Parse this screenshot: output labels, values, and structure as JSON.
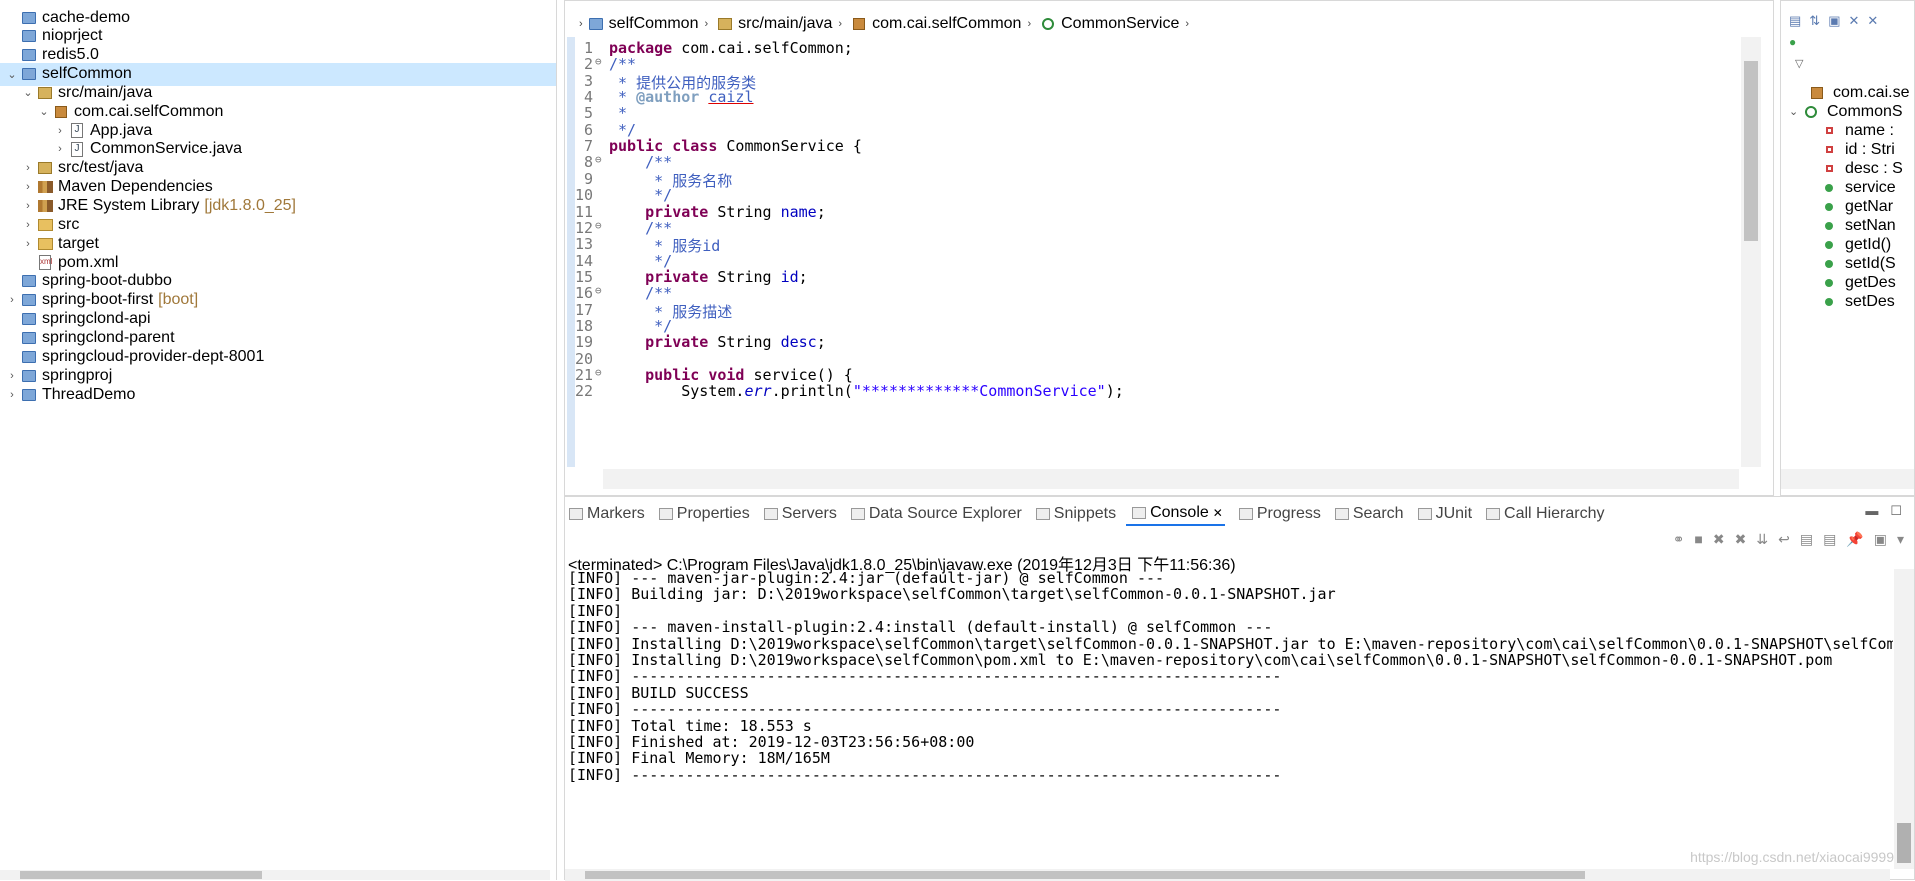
{
  "explorer": {
    "items": [
      {
        "label": "cache-demo",
        "suffix": "",
        "level": 0,
        "icon": "project-icon",
        "arrow": ""
      },
      {
        "label": "nioprject",
        "suffix": "",
        "level": 0,
        "icon": "project-icon",
        "arrow": ""
      },
      {
        "label": "redis5.0",
        "suffix": "",
        "level": 0,
        "icon": "project-icon",
        "arrow": ""
      },
      {
        "label": "selfCommon",
        "suffix": "",
        "level": 0,
        "icon": "maven-project-icon",
        "arrow": "v",
        "selected": true
      },
      {
        "label": "src/main/java",
        "suffix": "",
        "level": 1,
        "icon": "source-folder-icon",
        "arrow": "v"
      },
      {
        "label": "com.cai.selfCommon",
        "suffix": "",
        "level": 2,
        "icon": "package-icon",
        "arrow": "v"
      },
      {
        "label": "App.java",
        "suffix": "",
        "level": 3,
        "icon": "java-file-icon",
        "arrow": ">"
      },
      {
        "label": "CommonService.java",
        "suffix": "",
        "level": 3,
        "icon": "java-file-icon",
        "arrow": ">"
      },
      {
        "label": "src/test/java",
        "suffix": "",
        "level": 1,
        "icon": "source-folder-icon",
        "arrow": ">"
      },
      {
        "label": "Maven Dependencies",
        "suffix": "",
        "level": 1,
        "icon": "library-icon",
        "arrow": ">"
      },
      {
        "label": "JRE System Library",
        "suffix": "[jdk1.8.0_25]",
        "level": 1,
        "icon": "library-icon",
        "arrow": ">"
      },
      {
        "label": "src",
        "suffix": "",
        "level": 1,
        "icon": "folder-icon",
        "arrow": ">"
      },
      {
        "label": "target",
        "suffix": "",
        "level": 1,
        "icon": "folder-icon",
        "arrow": ">"
      },
      {
        "label": "pom.xml",
        "suffix": "",
        "level": 1,
        "icon": "xml-file-icon",
        "arrow": ""
      },
      {
        "label": "spring-boot-dubbo",
        "suffix": "",
        "level": 0,
        "icon": "project-icon",
        "arrow": ""
      },
      {
        "label": "spring-boot-first",
        "suffix": "[boot]",
        "level": 0,
        "icon": "spring-project-icon",
        "arrow": ">"
      },
      {
        "label": "springclond-api",
        "suffix": "",
        "level": 0,
        "icon": "project-icon",
        "arrow": ""
      },
      {
        "label": "springclond-parent",
        "suffix": "",
        "level": 0,
        "icon": "project-icon",
        "arrow": ""
      },
      {
        "label": "springcloud-provider-dept-8001",
        "suffix": "",
        "level": 0,
        "icon": "project-icon",
        "arrow": ""
      },
      {
        "label": "springproj",
        "suffix": "",
        "level": 0,
        "icon": "spring-project-icon",
        "arrow": ">"
      },
      {
        "label": "ThreadDemo",
        "suffix": "",
        "level": 0,
        "icon": "project-icon",
        "arrow": ">"
      }
    ]
  },
  "breadcrumb": [
    {
      "label": "selfCommon",
      "icon": "maven-project-icon"
    },
    {
      "label": "src/main/java",
      "icon": "source-folder-icon"
    },
    {
      "label": "com.cai.selfCommon",
      "icon": "package-icon"
    },
    {
      "label": "CommonService",
      "icon": "class-icon"
    }
  ],
  "code": [
    {
      "n": "1",
      "fold": "",
      "html": "<span class='kw'>package</span> com.cai.selfCommon;"
    },
    {
      "n": "2",
      "fold": "⊖",
      "html": "<span class='cm'>/**</span>"
    },
    {
      "n": "3",
      "fold": "",
      "html": "<span class='cm'> * 提供公用的服务类</span>"
    },
    {
      "n": "4",
      "fold": "",
      "html": "<span class='cm'> * <b style=\"color:#7f9fbf\">@author</b> <u style=\"text-decoration-color:#d00\">caizl</u></span>"
    },
    {
      "n": "5",
      "fold": "",
      "html": "<span class='cm'> *</span>"
    },
    {
      "n": "6",
      "fold": "",
      "html": "<span class='cm'> */</span>"
    },
    {
      "n": "7",
      "fold": "",
      "html": "<span class='kw'>public class</span> CommonService {"
    },
    {
      "n": "8",
      "fold": "⊖",
      "html": "    <span class='cm'>/**</span>"
    },
    {
      "n": "9",
      "fold": "",
      "html": "<span class='cm'>     * 服务名称</span>"
    },
    {
      "n": "10",
      "fold": "",
      "html": "<span class='cm'>     */</span>"
    },
    {
      "n": "11",
      "fold": "",
      "html": "    <span class='kw'>private</span> String <span class='fld'>name</span>;"
    },
    {
      "n": "12",
      "fold": "⊖",
      "html": "    <span class='cm'>/**</span>"
    },
    {
      "n": "13",
      "fold": "",
      "html": "<span class='cm'>     * 服务id</span>"
    },
    {
      "n": "14",
      "fold": "",
      "html": "<span class='cm'>     */</span>"
    },
    {
      "n": "15",
      "fold": "",
      "html": "    <span class='kw'>private</span> String <span class='fld'>id</span>;"
    },
    {
      "n": "16",
      "fold": "⊖",
      "html": "    <span class='cm'>/**</span>"
    },
    {
      "n": "17",
      "fold": "",
      "html": "<span class='cm'>     * 服务描述</span>"
    },
    {
      "n": "18",
      "fold": "",
      "html": "<span class='cm'>     */</span>"
    },
    {
      "n": "19",
      "fold": "",
      "html": "    <span class='kw'>private</span> String <span class='fld'>desc</span>;"
    },
    {
      "n": "20",
      "fold": "",
      "html": ""
    },
    {
      "n": "21",
      "fold": "⊖",
      "html": "    <span class='kw'>public void</span> service() {"
    },
    {
      "n": "22",
      "fold": "",
      "html": "        System.<i class='fld'>err</i>.println(<span class='str'>\"*************CommonService\"</span>);"
    }
  ],
  "outline": {
    "items": [
      {
        "label": "com.cai.se",
        "kind": "package",
        "indent": 30
      },
      {
        "label": "CommonS",
        "kind": "class",
        "indent": 10
      },
      {
        "label": "name :",
        "kind": "private",
        "indent": 55
      },
      {
        "label": "id : Stri",
        "kind": "private",
        "indent": 55
      },
      {
        "label": "desc : S",
        "kind": "private",
        "indent": 55
      },
      {
        "label": "service",
        "kind": "public",
        "indent": 55
      },
      {
        "label": "getNar",
        "kind": "public",
        "indent": 55
      },
      {
        "label": "setNan",
        "kind": "public",
        "indent": 55
      },
      {
        "label": "getId()",
        "kind": "public",
        "indent": 55
      },
      {
        "label": "setId(S",
        "kind": "public",
        "indent": 55
      },
      {
        "label": "getDes",
        "kind": "public",
        "indent": 55
      },
      {
        "label": "setDes",
        "kind": "public",
        "indent": 55
      }
    ]
  },
  "console": {
    "tabs": [
      {
        "label": "Markers",
        "active": false
      },
      {
        "label": "Properties",
        "active": false
      },
      {
        "label": "Servers",
        "active": false
      },
      {
        "label": "Data Source Explorer",
        "active": false
      },
      {
        "label": "Snippets",
        "active": false
      },
      {
        "label": "Console",
        "active": true
      },
      {
        "label": "Progress",
        "active": false
      },
      {
        "label": "Search",
        "active": false
      },
      {
        "label": "JUnit",
        "active": false
      },
      {
        "label": "Call Hierarchy",
        "active": false
      }
    ],
    "terminated": "<terminated> C:\\Program Files\\Java\\jdk1.8.0_25\\bin\\javaw.exe (2019年12月3日 下午11:56:36)",
    "lines": [
      "[INFO] --- maven-jar-plugin:2.4:jar (default-jar) @ selfCommon ---",
      "[INFO] Building jar: D:\\2019workspace\\selfCommon\\target\\selfCommon-0.0.1-SNAPSHOT.jar",
      "[INFO]",
      "[INFO] --- maven-install-plugin:2.4:install (default-install) @ selfCommon ---",
      "[INFO] Installing D:\\2019workspace\\selfCommon\\target\\selfCommon-0.0.1-SNAPSHOT.jar to E:\\maven-repository\\com\\cai\\selfCommon\\0.0.1-SNAPSHOT\\selfCom",
      "[INFO] Installing D:\\2019workspace\\selfCommon\\pom.xml to E:\\maven-repository\\com\\cai\\selfCommon\\0.0.1-SNAPSHOT\\selfCommon-0.0.1-SNAPSHOT.pom",
      "[INFO] ------------------------------------------------------------------------",
      "[INFO] BUILD SUCCESS",
      "[INFO] ------------------------------------------------------------------------",
      "[INFO] Total time: 18.553 s",
      "[INFO] Finished at: 2019-12-03T23:56:56+08:00",
      "[INFO] Final Memory: 18M/165M",
      "[INFO] ------------------------------------------------------------------------"
    ],
    "watermark": "https://blog.csdn.net/xiaocai9999"
  }
}
